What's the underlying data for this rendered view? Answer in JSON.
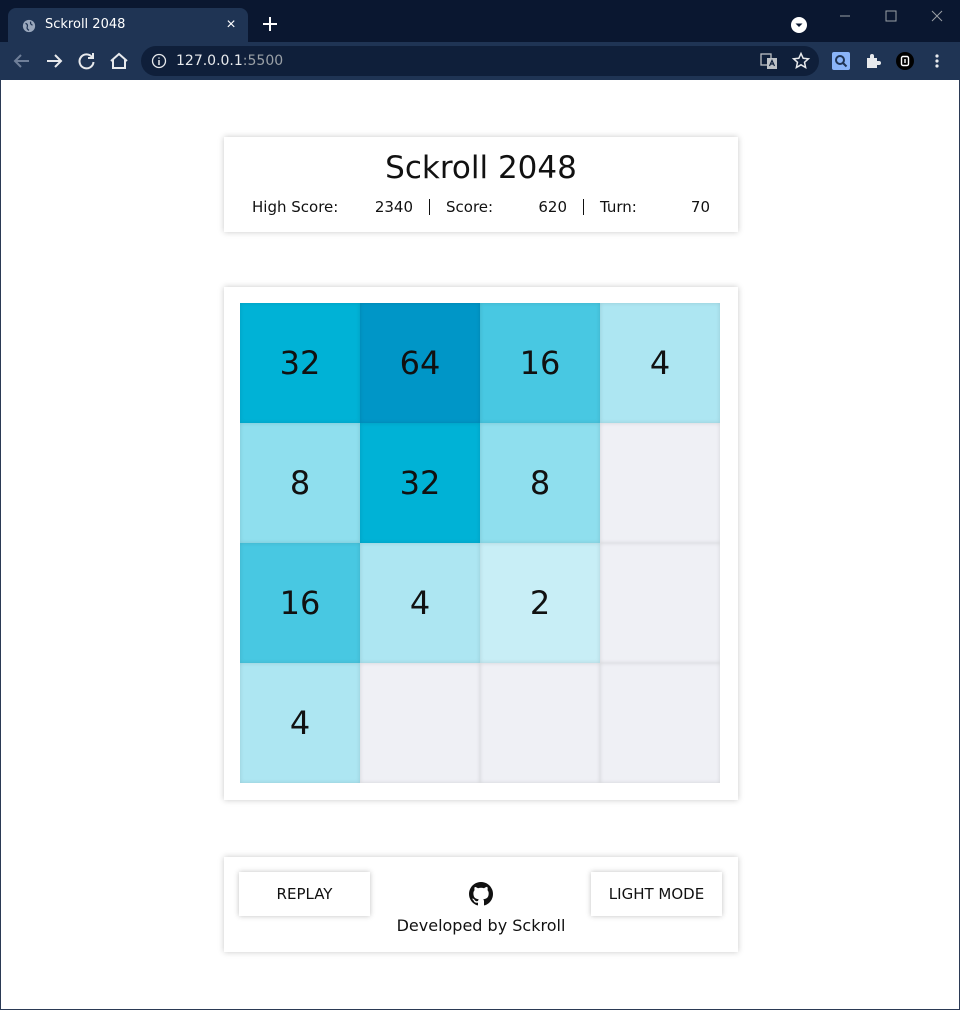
{
  "browser": {
    "tab_title": "Sckroll 2048",
    "url_host": "127.0.0.1",
    "url_port": ":5500"
  },
  "game": {
    "title": "Sckroll 2048",
    "high_score_label": "High Score:",
    "high_score": "2340",
    "score_label": "Score:",
    "score": "620",
    "turn_label": "Turn:",
    "turn": "70"
  },
  "board": {
    "rows": [
      [
        "32",
        "64",
        "16",
        "4"
      ],
      [
        "8",
        "32",
        "8",
        ""
      ],
      [
        "16",
        "4",
        "2",
        ""
      ],
      [
        "4",
        "",
        "",
        ""
      ]
    ]
  },
  "tile_colors": {
    "empty": "#eff0f5",
    "2": "#c8eef6",
    "4": "#ade6f2",
    "8": "#8fdfee",
    "16": "#48c8e2",
    "32": "#00b2d6",
    "64": "#0096c7"
  },
  "footer": {
    "replay_label": "REPLAY",
    "mode_label": "LIGHT MODE",
    "credit": "Developed by Sckroll",
    "github_icon": "github-icon"
  }
}
